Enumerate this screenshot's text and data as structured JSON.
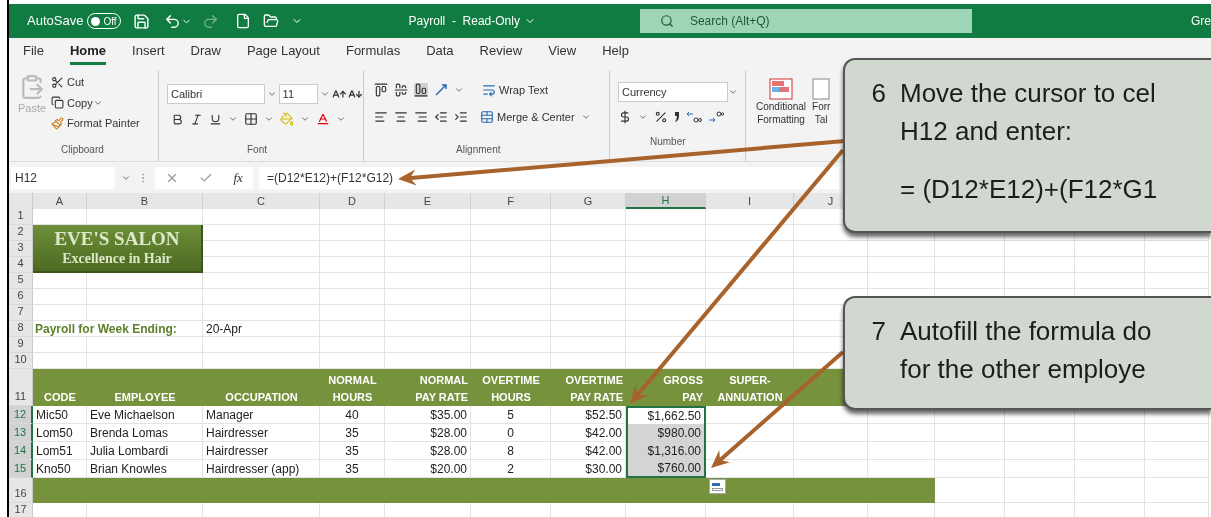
{
  "title_bar": {
    "autosave_label": "AutoSave",
    "autosave": {
      "label": "Off",
      "on": false
    },
    "document_title": "Payroll  -  Read-Only",
    "search": {
      "placeholder": "Search (Alt+Q)"
    },
    "user": "Gre"
  },
  "menu_tabs": [
    {
      "label": "File",
      "selected": false
    },
    {
      "label": "Home",
      "selected": true
    },
    {
      "label": "Insert",
      "selected": false
    },
    {
      "label": "Draw",
      "selected": false
    },
    {
      "label": "Page Layout",
      "selected": false
    },
    {
      "label": "Formulas",
      "selected": false
    },
    {
      "label": "Data",
      "selected": false
    },
    {
      "label": "Review",
      "selected": false
    },
    {
      "label": "View",
      "selected": false
    },
    {
      "label": "Help",
      "selected": false
    }
  ],
  "ribbon": {
    "clipboard": {
      "paste": "Paste",
      "cut": "Cut",
      "copy": "Copy",
      "format_painter": "Format Painter",
      "label": "Clipboard"
    },
    "font": {
      "name": "Calibri",
      "size": "11",
      "label": "Font"
    },
    "alignment": {
      "wrap_text": "Wrap Text",
      "merge_center": "Merge & Center",
      "label": "Alignment"
    },
    "number": {
      "format": "Currency",
      "label": "Number"
    },
    "styles": {
      "conditional_formatting": [
        "Conditional",
        "Formatting"
      ],
      "format_table": [
        "Forr",
        "Tal"
      ]
    }
  },
  "formula_bar": {
    "name_box": "H12",
    "fx": "fx",
    "formula": "=(D12*E12)+(F12*G12)"
  },
  "logo": {
    "title": "EVE'S SALON",
    "subtitle": "Excellence in Hair"
  },
  "sheet": {
    "columns": [
      {
        "label": "A",
        "selected": false
      },
      {
        "label": "B",
        "selected": false
      },
      {
        "label": "C",
        "selected": false
      },
      {
        "label": "D",
        "selected": false
      },
      {
        "label": "E",
        "selected": false
      },
      {
        "label": "F",
        "selected": false
      },
      {
        "label": "G",
        "selected": false
      },
      {
        "label": "H",
        "selected": true
      },
      {
        "label": "I",
        "selected": false
      },
      {
        "label": "J",
        "selected": false
      }
    ],
    "headings": [
      [
        "CODE"
      ],
      [
        "EMPLOYEE"
      ],
      [
        "OCCUPATION"
      ],
      [
        "NORMAL",
        "HOURS"
      ],
      [
        "NORMAL",
        "PAY RATE"
      ],
      [
        "OVERTIME",
        "HOURS"
      ],
      [
        "OVERTIME",
        "PAY RATE"
      ],
      [
        "GROSS",
        "PAY"
      ],
      [
        "SUPER-",
        "ANNUATION"
      ]
    ],
    "rows": [
      {
        "number": "1",
        "kind": "blank",
        "selected": false
      },
      {
        "number": "2",
        "kind": "blank",
        "selected": false
      },
      {
        "number": "3",
        "kind": "blank",
        "selected": false
      },
      {
        "number": "4",
        "kind": "blank",
        "selected": false
      },
      {
        "number": "5",
        "kind": "blank",
        "selected": false
      },
      {
        "number": "6",
        "kind": "blank",
        "selected": false
      },
      {
        "number": "7",
        "kind": "blank",
        "selected": false
      },
      {
        "number": "8",
        "kind": "label",
        "selected": false,
        "label": "Payroll for Week Ending:",
        "value": "20-Apr"
      },
      {
        "number": "9",
        "kind": "blank",
        "selected": false
      },
      {
        "number": "10",
        "kind": "blank",
        "selected": false
      },
      {
        "number": "11",
        "kind": "header",
        "selected": false
      },
      {
        "number": "12",
        "kind": "data",
        "selected": true,
        "active": true,
        "cells": [
          "Mic50",
          "Eve Michaelson",
          "Manager",
          "40",
          "$35.00",
          "5",
          "$52.50",
          "$1,662.50"
        ]
      },
      {
        "number": "13",
        "kind": "data",
        "selected": true,
        "active": false,
        "cells": [
          "Lom50",
          "Brenda Lomas",
          "Hairdresser",
          "35",
          "$28.00",
          "0",
          "$42.00",
          "$980.00"
        ]
      },
      {
        "number": "14",
        "kind": "data",
        "selected": true,
        "active": false,
        "cells": [
          "Lom51",
          "Julia Lombardi",
          "Hairdresser",
          "35",
          "$28.00",
          "8",
          "$42.00",
          "$1,316.00"
        ]
      },
      {
        "number": "15",
        "kind": "data",
        "selected": true,
        "active": false,
        "cells": [
          "Kno50",
          "Brian Knowles",
          "Hairdresser (app)",
          "35",
          "$20.00",
          "2",
          "$30.00",
          "$760.00"
        ]
      },
      {
        "number": "16",
        "kind": "band",
        "selected": false
      },
      {
        "number": "17",
        "kind": "blank",
        "selected": false
      }
    ]
  },
  "callouts": [
    {
      "number": "6",
      "lines": [
        "Move the cursor to cel",
        "H12 and enter:",
        "= (D12*E12)+(F12*G1"
      ]
    },
    {
      "number": "7",
      "lines": [
        "Autofill the formula do",
        "for the other employe"
      ]
    }
  ]
}
